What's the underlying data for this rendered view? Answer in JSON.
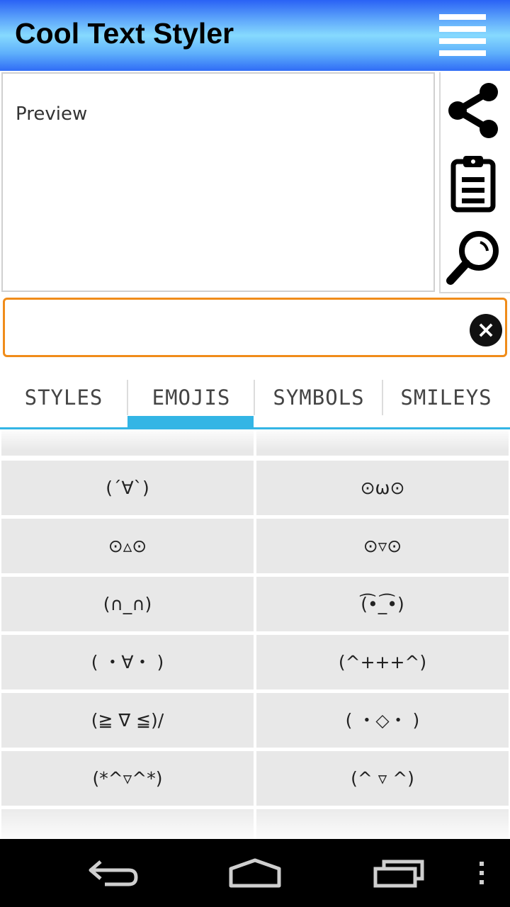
{
  "app": {
    "title": "Cool Text Styler"
  },
  "preview": {
    "label": "Preview"
  },
  "input": {
    "value": "",
    "placeholder": ""
  },
  "icons": {
    "menu": "menu-icon",
    "share": "share-icon",
    "clipboard": "clipboard-icon",
    "search": "magnifier-icon",
    "clear": "clear-icon"
  },
  "tabs": [
    {
      "label": "STYLES"
    },
    {
      "label": "EMOJIS",
      "selected": true
    },
    {
      "label": "SYMBOLS"
    },
    {
      "label": "SMILEYS"
    }
  ],
  "emojis": [
    [
      "(´∀`)",
      "⊙ω⊙"
    ],
    [
      "⊙▵⊙",
      "⊙▿⊙"
    ],
    [
      "(∩_∩)",
      "(͡•_͡•)"
    ],
    [
      "( ・∀・ )",
      "(^+++^)"
    ],
    [
      "(≧ ∇ ≦)/",
      "( ・◇・ )"
    ],
    [
      "(*^▿^*)",
      "(^ ▿ ^)"
    ]
  ],
  "colors": {
    "accent_tab": "#33b5e5",
    "input_border": "#f08c1a",
    "cell_bg": "#e8e8e8"
  }
}
